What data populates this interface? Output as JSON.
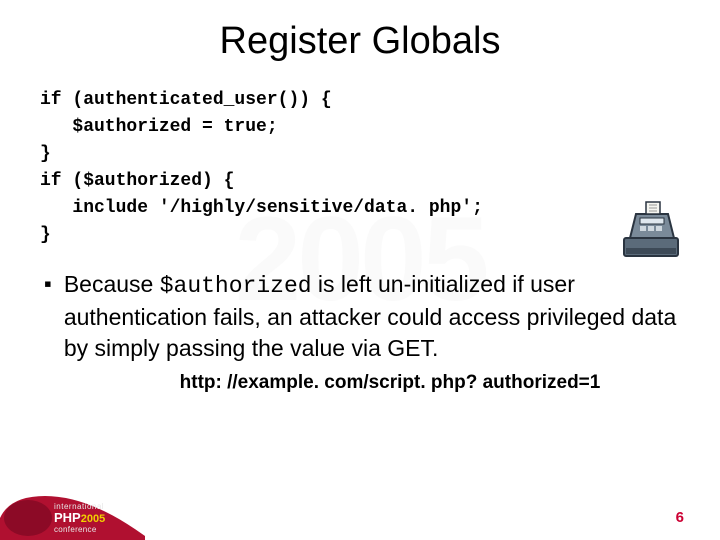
{
  "title": "Register Globals",
  "code": "if (authenticated_user()) {\n   $authorized = true;\n}\nif ($authorized) {\n   include '/highly/sensitive/data. php';\n}",
  "bullet": {
    "pre": "Because ",
    "code": "$authorized",
    "post": " is left un-initialized if user authentication fails, an attacker could access privileged data by simply passing the value via GET."
  },
  "url": "http: //example. com/script. php? authorized=1",
  "pageNumber": "6",
  "logo": {
    "line1": "international",
    "php": "PHP",
    "year": "2005",
    "line3": "conference"
  }
}
